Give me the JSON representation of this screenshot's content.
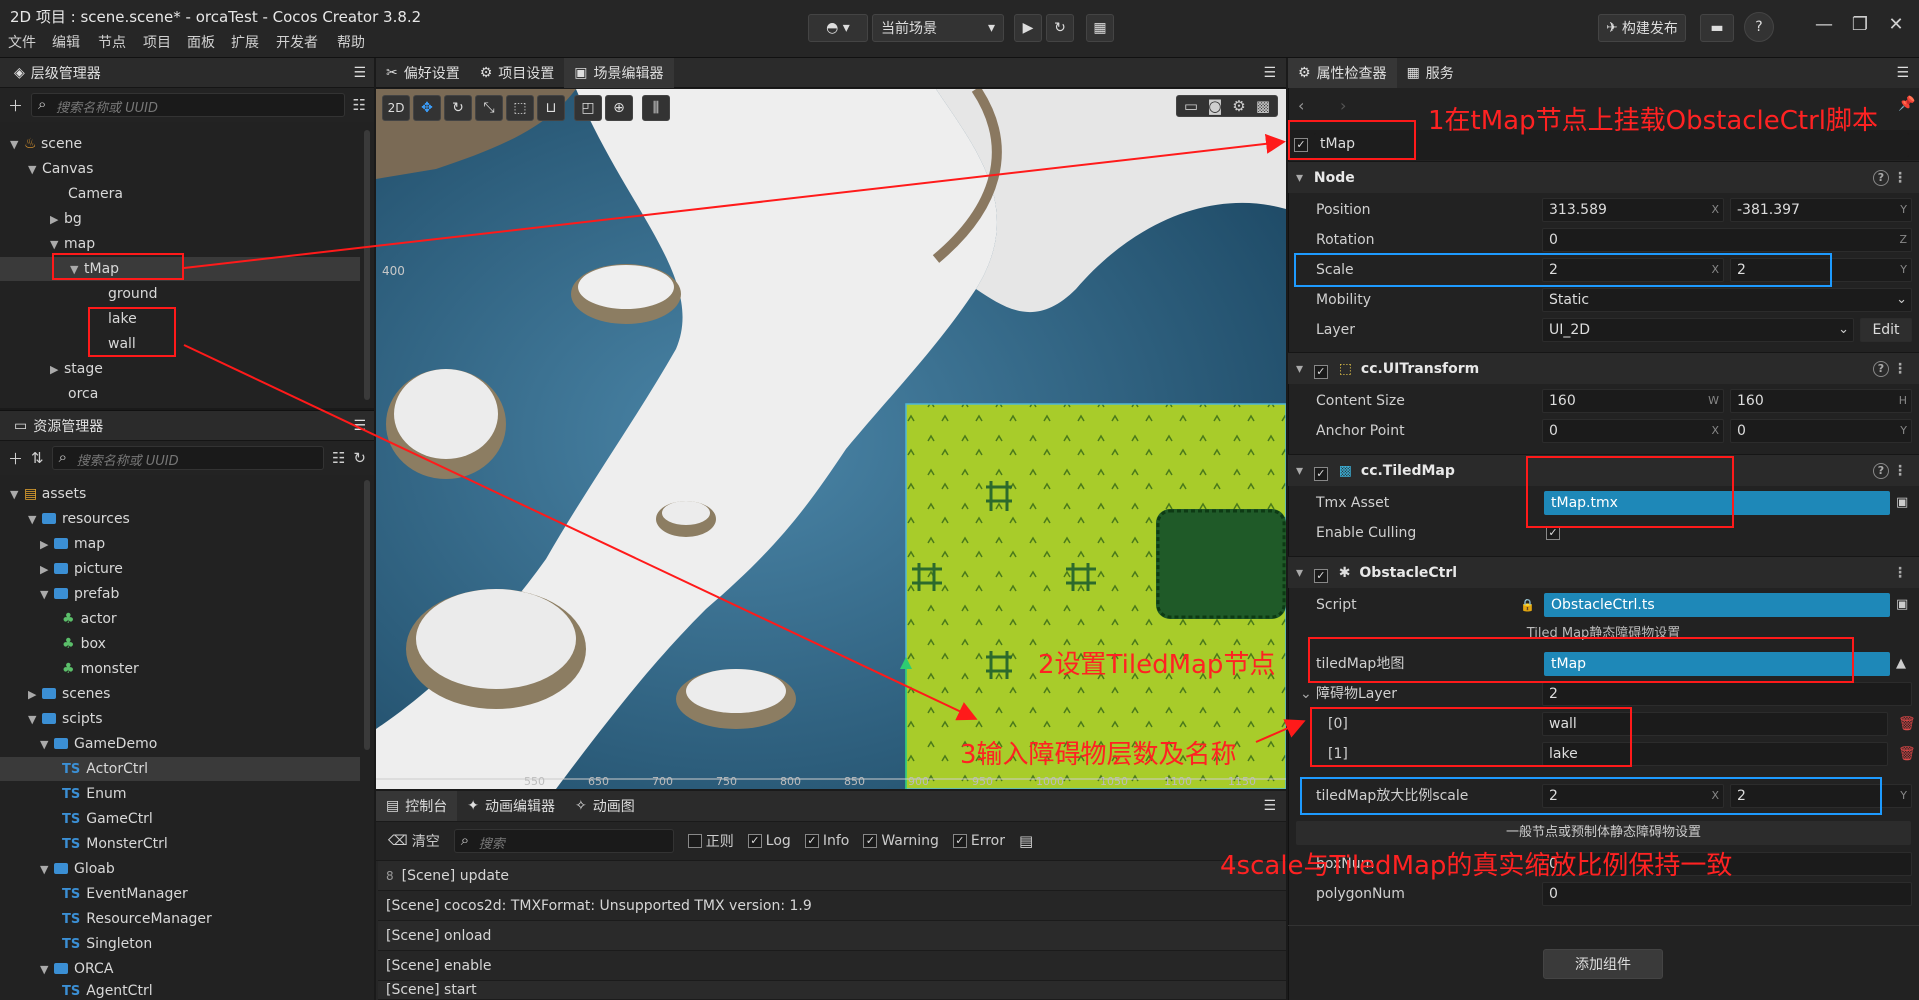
{
  "window": {
    "title": "2D 项目 : scene.scene* - orcaTest - Cocos Creator 3.8.2",
    "menu": [
      "文件",
      "编辑",
      "节点",
      "项目",
      "面板",
      "扩展",
      "开发者",
      "帮助"
    ],
    "scene_select": "当前场景",
    "build_button": "构建发布"
  },
  "hierarchy": {
    "tab": "层级管理器",
    "search_placeholder": "搜索名称或 UUID",
    "items": [
      {
        "label": "scene"
      },
      {
        "label": "Canvas"
      },
      {
        "label": "Camera"
      },
      {
        "label": "bg"
      },
      {
        "label": "map"
      },
      {
        "label": "tMap"
      },
      {
        "label": "ground"
      },
      {
        "label": "lake"
      },
      {
        "label": "wall"
      },
      {
        "label": "stage"
      },
      {
        "label": "orca"
      }
    ]
  },
  "assets": {
    "tab": "资源管理器",
    "search_placeholder": "搜索名称或 UUID",
    "items": [
      {
        "label": "assets"
      },
      {
        "label": "resources"
      },
      {
        "label": "map"
      },
      {
        "label": "picture"
      },
      {
        "label": "prefab"
      },
      {
        "label": "actor"
      },
      {
        "label": "box"
      },
      {
        "label": "monster"
      },
      {
        "label": "scenes"
      },
      {
        "label": "scipts"
      },
      {
        "label": "GameDemo"
      },
      {
        "label": "ActorCtrl"
      },
      {
        "label": "Enum"
      },
      {
        "label": "GameCtrl"
      },
      {
        "label": "MonsterCtrl"
      },
      {
        "label": "Gloab"
      },
      {
        "label": "EventManager"
      },
      {
        "label": "ResourceManager"
      },
      {
        "label": "Singleton"
      },
      {
        "label": "ORCA"
      },
      {
        "label": "AgentCtrl"
      }
    ]
  },
  "center_tabs": {
    "pref": "偏好设置",
    "project": "项目设置",
    "scene": "场景编辑器"
  },
  "scene_view": {
    "mode": "2D",
    "ruler_left": "400",
    "ruler_bottom": [
      "550",
      "650",
      "700",
      "750",
      "800",
      "850",
      "900",
      "950",
      "1000",
      "1050",
      "1100",
      "1150",
      "1200"
    ]
  },
  "console": {
    "tabs": [
      "控制台",
      "动画编辑器",
      "动画图"
    ],
    "clear": "清空",
    "search_placeholder": "搜索",
    "filters": [
      "正则",
      "Log",
      "Info",
      "Warning",
      "Error"
    ],
    "lines": [
      {
        "count": "8",
        "text": "[Scene] update"
      },
      {
        "count": "",
        "text": "[Scene] cocos2d: TMXFormat: Unsupported TMX version: 1.9"
      },
      {
        "count": "",
        "text": "[Scene] onload"
      },
      {
        "count": "",
        "text": "[Scene] enable"
      },
      {
        "count": "",
        "text": "[Scene] start"
      }
    ]
  },
  "inspector": {
    "tabs": [
      "属性检查器",
      "服务"
    ],
    "node_name": "tMap",
    "node_section": "Node",
    "position_label": "Position",
    "position_x": "313.589",
    "position_y": "-381.397",
    "rotation_label": "Rotation",
    "rotation": "0",
    "scale_label": "Scale",
    "scale_x": "2",
    "scale_y": "2",
    "mobility_label": "Mobility",
    "mobility": "Static",
    "layer_label": "Layer",
    "layer": "UI_2D",
    "edit": "Edit",
    "uitransform": "cc.UITransform",
    "content_size_label": "Content Size",
    "cs_w": "160",
    "cs_h": "160",
    "anchor_label": "Anchor Point",
    "anchor_x": "0",
    "anchor_y": "0",
    "tiledmap": "cc.TiledMap",
    "tmx_label": "Tmx Asset",
    "tmx": "tMap.tmx",
    "culling_label": "Enable Culling",
    "obstacle": "ObstacleCtrl",
    "script_label": "Script",
    "script": "ObstacleCtrl.ts",
    "tiled_group": "Tiled Map静态障碍物设置",
    "tiledmap_label": "tiledMap地图",
    "tiledmap_value": "tMap",
    "obs_layer_label": "障碍物Layer",
    "obs_layer_count": "2",
    "idx0_label": "[0]",
    "idx0": "wall",
    "idx1_label": "[1]",
    "idx1": "lake",
    "scale2_label": "tiledMap放大比例scale",
    "scale2_x": "2",
    "scale2_y": "2",
    "general_group": "一般节点或预制体静态障碍物设置",
    "box_label": "boxNum",
    "box": "0",
    "poly_label": "polygonNum",
    "poly": "0",
    "add_component": "添加组件"
  },
  "annotations": {
    "a1": "1在tMap节点上挂载ObstacleCtrl脚本",
    "a2": "2设置TiledMap节点",
    "a3": "3输入障碍物层数及名称",
    "a4": "4scale与TiledMap的真实缩放比例保持一致"
  }
}
